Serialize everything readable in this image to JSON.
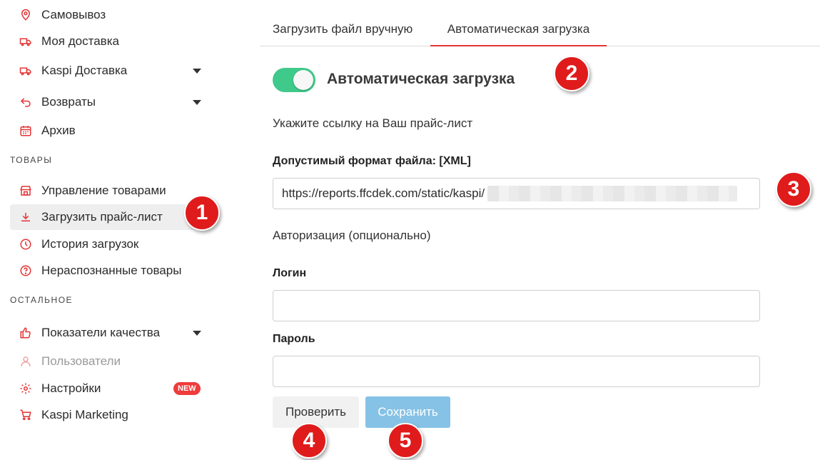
{
  "sidebar": {
    "items_top": [
      {
        "label": "Самовывоз",
        "icon": "location-pin-icon"
      },
      {
        "label": "Моя доставка",
        "icon": "truck-icon"
      },
      {
        "label": "Kaspi Доставка",
        "icon": "truck-icon"
      },
      {
        "label": "Возвраты",
        "icon": "return-arrow-icon"
      },
      {
        "label": "Архив",
        "icon": "calendar-icon"
      }
    ],
    "section_products": "ТОВАРЫ",
    "items_products": [
      {
        "label": "Управление товарами",
        "icon": "store-icon"
      },
      {
        "label": "Загрузить прайс-лист",
        "icon": "download-icon"
      },
      {
        "label": "История загрузок",
        "icon": "clock-icon"
      },
      {
        "label": "Нераспознанные товары",
        "icon": "question-circle-icon"
      }
    ],
    "section_other": "ОСТАЛЬНОЕ",
    "items_other": [
      {
        "label": "Показатели качества",
        "icon": "thumbs-up-icon"
      },
      {
        "label": "Пользователи",
        "icon": "user-icon"
      },
      {
        "label": "Настройки",
        "icon": "gear-icon",
        "badge": "NEW"
      },
      {
        "label": "Kaspi Marketing",
        "icon": "cart-icon"
      }
    ]
  },
  "tabs": [
    {
      "label": "Загрузить файл вручную"
    },
    {
      "label": "Автоматическая загрузка"
    }
  ],
  "auto_upload": {
    "toggle_label": "Автоматическая загрузка",
    "toggle_on": true,
    "instruction": "Укажите ссылку на Ваш прайс-лист",
    "format_label": "Допустимый формат файла: [XML]",
    "url_value": "https://reports.ffcdek.com/static/kaspi/",
    "auth_title": "Авторизация (опционально)",
    "login_label": "Логин",
    "login_value": "",
    "password_label": "Пароль",
    "password_value": ""
  },
  "buttons": {
    "check": "Проверить",
    "save": "Сохранить"
  },
  "markers": [
    "1",
    "2",
    "3",
    "4",
    "5"
  ],
  "colors": {
    "accent_red": "#e43434",
    "toggle_green": "#3fc98a",
    "save_blue": "#86c2e6",
    "badge_red": "#ef3b3b"
  }
}
